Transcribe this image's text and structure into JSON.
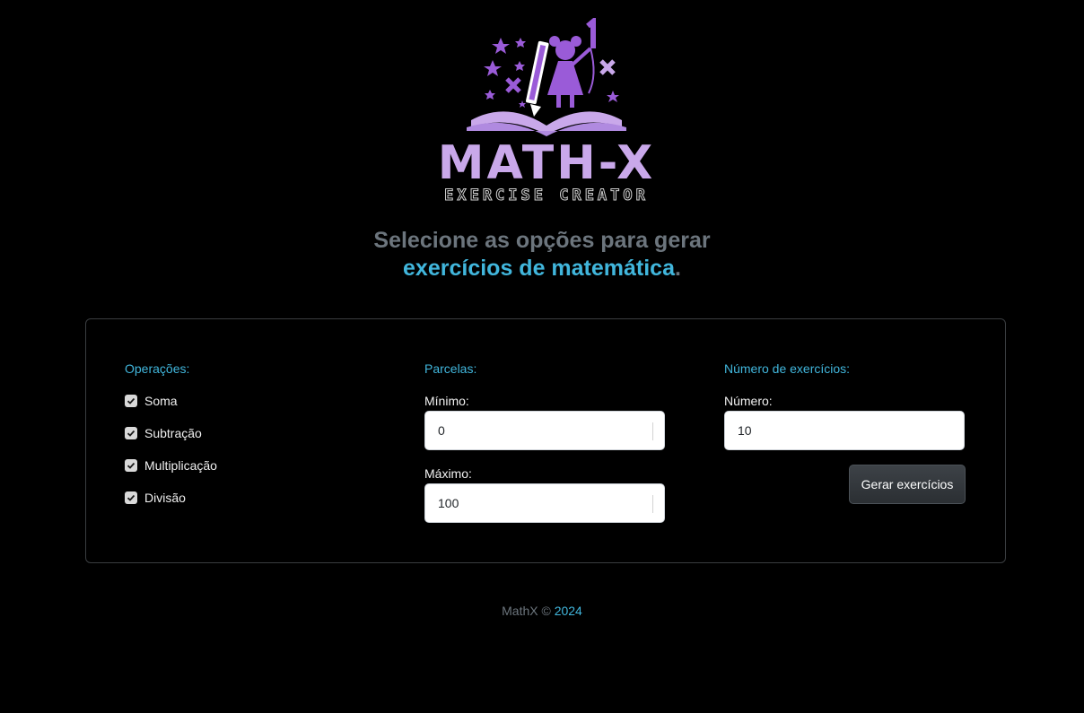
{
  "brand": {
    "logo_title": "MATH-X",
    "logo_subtitle": "EXERCISE CREATOR",
    "logo_color": "#c9a8ea",
    "logo_accent": "#9a5bd8"
  },
  "headline": {
    "line1": "Selecione as opções para gerar",
    "line2_accent": "exercícios de matemática",
    "line2_end": "."
  },
  "operations": {
    "title": "Operações:",
    "items": [
      {
        "label": "Soma",
        "checked": true
      },
      {
        "label": "Subtração",
        "checked": true
      },
      {
        "label": "Multiplicação",
        "checked": true
      },
      {
        "label": "Divisão",
        "checked": true
      }
    ]
  },
  "parcelas": {
    "title": "Parcelas:",
    "min_label": "Mínimo:",
    "min_value": "0",
    "max_label": "Máximo:",
    "max_value": "100"
  },
  "exercises": {
    "title": "Número de exercícios:",
    "count_label": "Número:",
    "count_value": "10",
    "generate_button": "Gerar exercícios"
  },
  "footer": {
    "brand": "MathX ©",
    "year": "2024"
  },
  "colors": {
    "accent": "#41b6dc",
    "muted": "#6c757d",
    "background": "#000000"
  }
}
